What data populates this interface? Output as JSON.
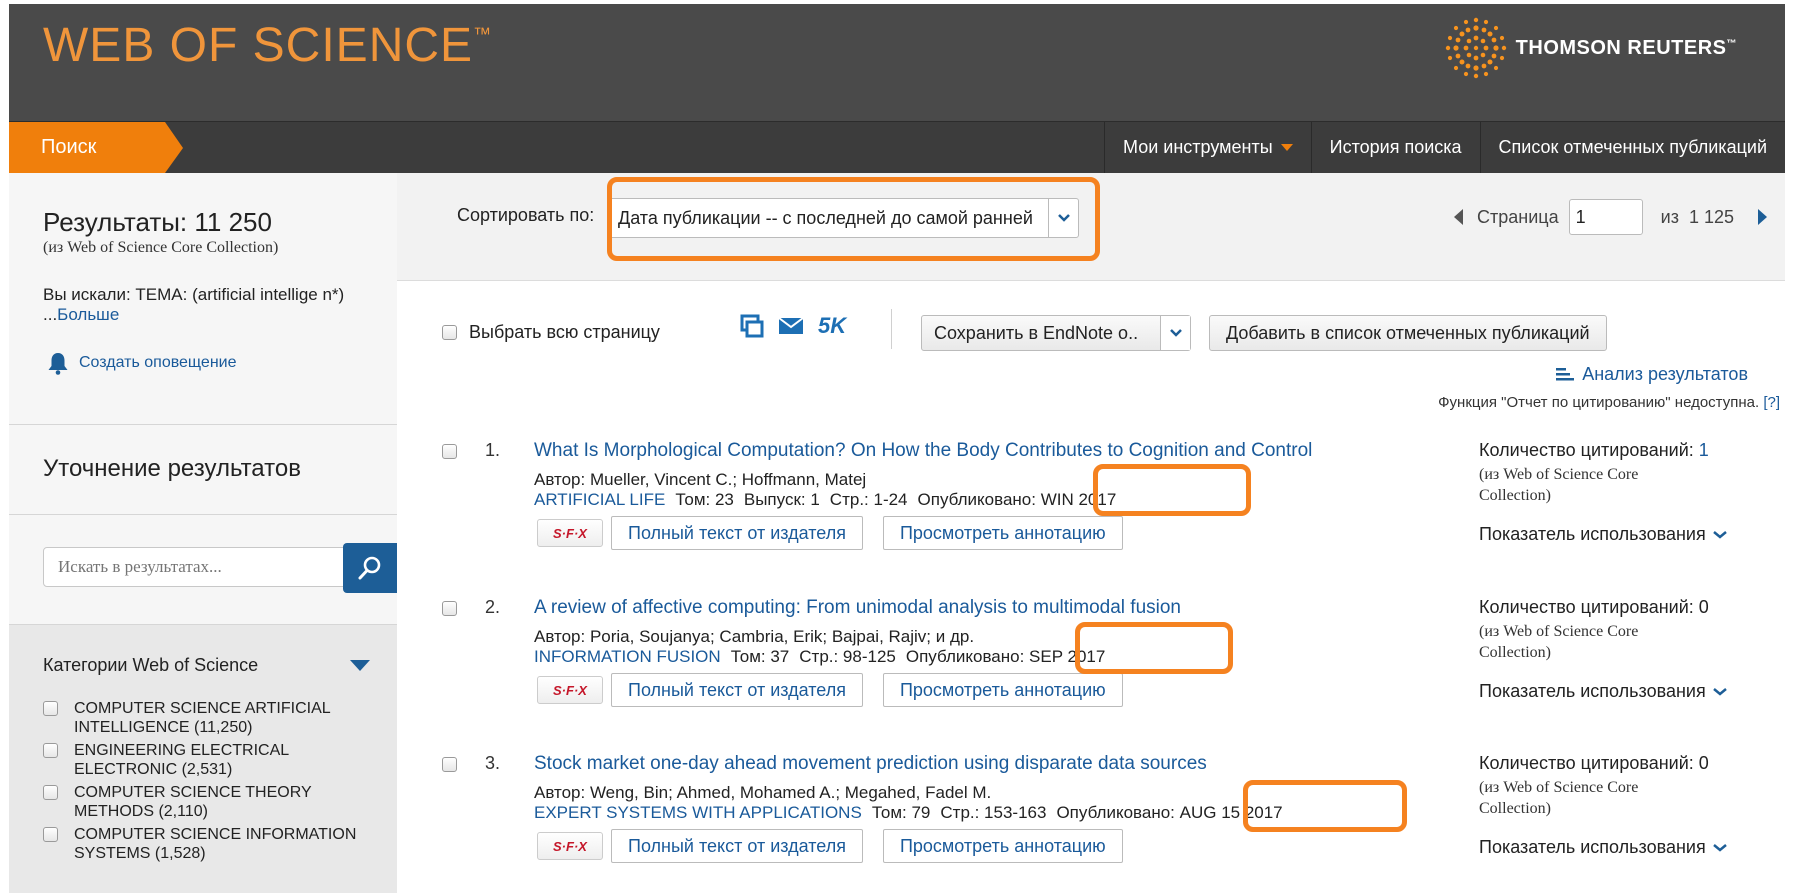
{
  "header": {
    "logo": "WEB OF SCIENCE",
    "logo_tm": "™",
    "publisher": "THOMSON REUTERS",
    "publisher_tm": "™"
  },
  "nav": {
    "search_tab": "Поиск",
    "my_tools": "Мои инструменты",
    "search_history": "История поиска",
    "marked_list": "Список отмеченных публикаций"
  },
  "sidebar": {
    "results_label": "Результаты: 11 250",
    "results_source": "(из Web of Science Core Collection)",
    "you_searched": "Вы искали: ТЕМА: (artificial intellige n*) ...",
    "more": "Больше",
    "create_alert": "Создать оповещение",
    "refine_title": "Уточнение результатов",
    "search_in_results_placeholder": "Искать в результатах...",
    "categories_title": "Категории Web of Science",
    "categories": [
      {
        "label": "COMPUTER SCIENCE ARTIFICIAL INTELLIGENCE (11,250)"
      },
      {
        "label": "ENGINEERING ELECTRICAL ELECTRONIC (2,531)"
      },
      {
        "label": "COMPUTER SCIENCE THEORY METHODS (2,110)"
      },
      {
        "label": "COMPUTER SCIENCE INFORMATION SYSTEMS (1,528)"
      }
    ]
  },
  "sort": {
    "label": "Сортировать по:",
    "value": "Дата публикации -- с последней до самой ранней"
  },
  "pager": {
    "page_label": "Страница",
    "current": "1",
    "of": "из",
    "total": "1 125"
  },
  "toolbar": {
    "select_all": "Выбрать всю страницу",
    "five_k": "5K",
    "save_to": "Сохранить в EndNote o..",
    "add_to_marked": "Добавить в список отмеченных публикаций",
    "analyze": "Анализ результатов",
    "citation_report_note": "Функция \"Отчет по цитированию\" недоступна.",
    "help": "[?]"
  },
  "records": [
    {
      "num": "1.",
      "title": "What Is Morphological Computation? On How the Body Contributes to Cognition and Control",
      "authors": "Автор: Mueller, Vincent C.; Hoffmann, Matej",
      "journal": "ARTIFICIAL LIFE",
      "volume": "Том: 23",
      "issue": "Выпуск: 1",
      "pages": "Стр.: 1-24",
      "published": "Опубликовано: WIN 2017",
      "citations_label": "Количество цитирований:",
      "citations": "1",
      "citations_source": "(из Web of Science Core Collection)",
      "usage": "Показатель использования"
    },
    {
      "num": "2.",
      "title": "A review of affective computing: From unimodal analysis to multimodal fusion",
      "authors": "Автор: Poria, Soujanya; Cambria, Erik; Bajpai, Rajiv; и др.",
      "journal": "INFORMATION FUSION",
      "volume": "Том: 37",
      "issue": "",
      "pages": "Стр.: 98-125",
      "published": "Опубликовано: SEP 2017",
      "citations_label": "Количество цитирований:",
      "citations": "0",
      "citations_source": "(из Web of Science Core Collection)",
      "usage": "Показатель использования"
    },
    {
      "num": "3.",
      "title": "Stock market one-day ahead movement prediction using disparate data sources",
      "authors": "Автор: Weng, Bin; Ahmed, Mohamed A.; Megahed, Fadel M.",
      "journal": "EXPERT SYSTEMS WITH APPLICATIONS",
      "volume": "Том: 79",
      "issue": "",
      "pages": "Стр.: 153-163",
      "published": "Опубликовано: AUG 15 2017",
      "citations_label": "Количество цитирований:",
      "citations": "0",
      "citations_source": "(из Web of Science Core Collection)",
      "usage": "Показатель использования"
    }
  ],
  "record_actions": {
    "sfx": "S·F·X",
    "full_text": "Полный текст от издателя",
    "view_abstract": "Просмотреть аннотацию"
  },
  "colors": {
    "header_bg": "#4a4a4a",
    "accent_orange": "#f07f0c",
    "link_blue": "#1a5a9a",
    "highlight_frame": "#f58220"
  }
}
